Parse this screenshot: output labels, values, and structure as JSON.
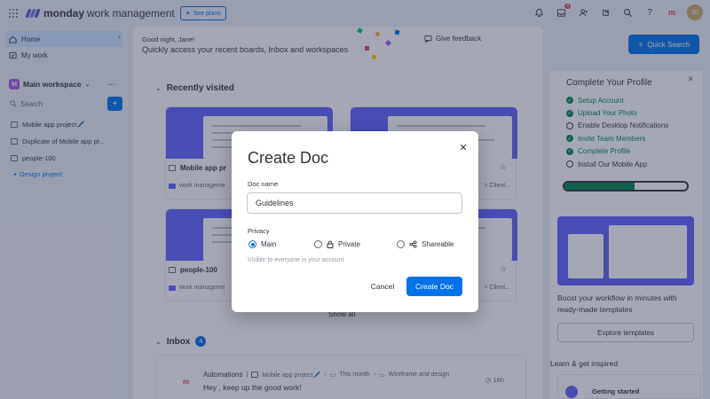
{
  "topbar": {
    "brand": "monday",
    "brand_suffix": "work management",
    "see_plans": "See plans",
    "notifications_badge": "4",
    "avatar_initials": "JG",
    "apps_logo": "m"
  },
  "sidebar": {
    "items": [
      {
        "label": "Home",
        "icon": "home-icon",
        "active": true
      },
      {
        "label": "My work",
        "icon": "my-work-icon",
        "active": false
      }
    ],
    "workspace": {
      "badge": "M",
      "name": "Main workspace"
    },
    "search_placeholder": "Search",
    "boards": [
      {
        "label": "Mobile app project🖊️"
      },
      {
        "label": "Duplicate of Mobile app pr..."
      },
      {
        "label": "people-100"
      }
    ],
    "folder": {
      "label": "Design project"
    }
  },
  "main": {
    "greeting": "Good night, Jane!",
    "subtitle": "Quickly access your recent boards, Inbox and workspaces",
    "feedback": "Give feedback",
    "quick_search": "Quick Search",
    "recently_visited": "Recently visited",
    "cards": [
      {
        "name": "Mobile app pr",
        "path": "work manageme",
        "path_right": ""
      },
      {
        "name": "",
        "path": "",
        "path_right": "> Client..."
      },
      {
        "name": "people-100",
        "path": "work manageme",
        "path_right": ""
      },
      {
        "name": "",
        "path": "",
        "path_right": "> Client..."
      }
    ],
    "show_all": "Show all",
    "inbox": {
      "title": "Inbox",
      "count": "4",
      "logo": "m",
      "who": "Automations",
      "crumb1": "Mobile app project🖊️",
      "crumb2": "This month",
      "crumb3": "Wireframe and design",
      "message": "Hey , keep up the good work!",
      "time": "16h"
    }
  },
  "profile": {
    "title": "Complete Your Profile",
    "items": [
      {
        "label": "Setup Account",
        "done": true
      },
      {
        "label": "Upload Your Photo",
        "done": true
      },
      {
        "label": "Enable Desktop Notifications",
        "done": false
      },
      {
        "label": "Invite Team Members",
        "done": true
      },
      {
        "label": "Complete Profile",
        "done": true
      },
      {
        "label": "Install Our Mobile App",
        "done": false
      }
    ],
    "progress": 0.57
  },
  "templates": {
    "text": "Boost your workflow in minutes with ready-made templates",
    "button": "Explore templates"
  },
  "learn": {
    "title": "Learn & get inspired",
    "card_title": "Getting started"
  },
  "modal": {
    "title": "Create Doc",
    "doc_name_label": "Doc name",
    "doc_name_value": "Guidelines",
    "privacy_label": "Privacy",
    "options": [
      {
        "label": "Main",
        "selected": true
      },
      {
        "label": "Private",
        "selected": false
      },
      {
        "label": "Shareable",
        "selected": false
      }
    ],
    "help_text": "Visible to everyone in your account",
    "cancel": "Cancel",
    "create": "Create Doc"
  },
  "colors": {
    "primary": "#0073ea",
    "done_green": "#00854d",
    "thumb": "#6161ff"
  }
}
